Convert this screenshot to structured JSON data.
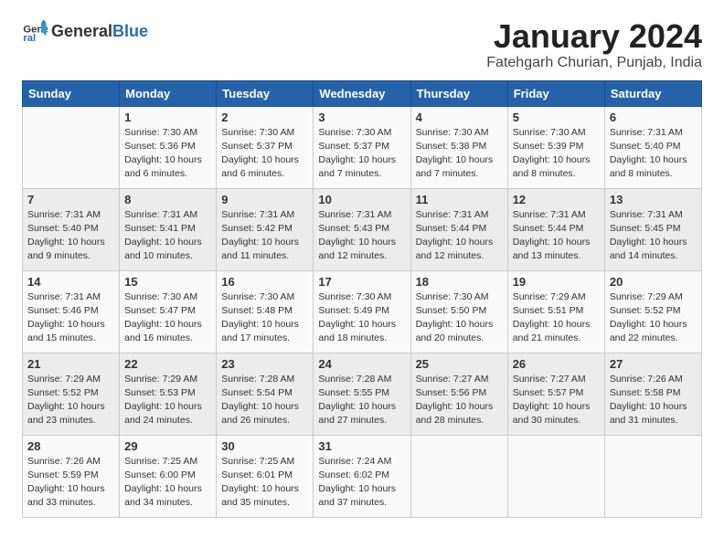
{
  "header": {
    "logo_general": "General",
    "logo_blue": "Blue",
    "title": "January 2024",
    "subtitle": "Fatehgarh Churian, Punjab, India"
  },
  "columns": [
    "Sunday",
    "Monday",
    "Tuesday",
    "Wednesday",
    "Thursday",
    "Friday",
    "Saturday"
  ],
  "weeks": [
    [
      {
        "day": "",
        "info": ""
      },
      {
        "day": "1",
        "info": "Sunrise: 7:30 AM\nSunset: 5:36 PM\nDaylight: 10 hours\nand 6 minutes."
      },
      {
        "day": "2",
        "info": "Sunrise: 7:30 AM\nSunset: 5:37 PM\nDaylight: 10 hours\nand 6 minutes."
      },
      {
        "day": "3",
        "info": "Sunrise: 7:30 AM\nSunset: 5:37 PM\nDaylight: 10 hours\nand 7 minutes."
      },
      {
        "day": "4",
        "info": "Sunrise: 7:30 AM\nSunset: 5:38 PM\nDaylight: 10 hours\nand 7 minutes."
      },
      {
        "day": "5",
        "info": "Sunrise: 7:30 AM\nSunset: 5:39 PM\nDaylight: 10 hours\nand 8 minutes."
      },
      {
        "day": "6",
        "info": "Sunrise: 7:31 AM\nSunset: 5:40 PM\nDaylight: 10 hours\nand 8 minutes."
      }
    ],
    [
      {
        "day": "7",
        "info": "Sunrise: 7:31 AM\nSunset: 5:40 PM\nDaylight: 10 hours\nand 9 minutes."
      },
      {
        "day": "8",
        "info": "Sunrise: 7:31 AM\nSunset: 5:41 PM\nDaylight: 10 hours\nand 10 minutes."
      },
      {
        "day": "9",
        "info": "Sunrise: 7:31 AM\nSunset: 5:42 PM\nDaylight: 10 hours\nand 11 minutes."
      },
      {
        "day": "10",
        "info": "Sunrise: 7:31 AM\nSunset: 5:43 PM\nDaylight: 10 hours\nand 12 minutes."
      },
      {
        "day": "11",
        "info": "Sunrise: 7:31 AM\nSunset: 5:44 PM\nDaylight: 10 hours\nand 12 minutes."
      },
      {
        "day": "12",
        "info": "Sunrise: 7:31 AM\nSunset: 5:44 PM\nDaylight: 10 hours\nand 13 minutes."
      },
      {
        "day": "13",
        "info": "Sunrise: 7:31 AM\nSunset: 5:45 PM\nDaylight: 10 hours\nand 14 minutes."
      }
    ],
    [
      {
        "day": "14",
        "info": "Sunrise: 7:31 AM\nSunset: 5:46 PM\nDaylight: 10 hours\nand 15 minutes."
      },
      {
        "day": "15",
        "info": "Sunrise: 7:30 AM\nSunset: 5:47 PM\nDaylight: 10 hours\nand 16 minutes."
      },
      {
        "day": "16",
        "info": "Sunrise: 7:30 AM\nSunset: 5:48 PM\nDaylight: 10 hours\nand 17 minutes."
      },
      {
        "day": "17",
        "info": "Sunrise: 7:30 AM\nSunset: 5:49 PM\nDaylight: 10 hours\nand 18 minutes."
      },
      {
        "day": "18",
        "info": "Sunrise: 7:30 AM\nSunset: 5:50 PM\nDaylight: 10 hours\nand 20 minutes."
      },
      {
        "day": "19",
        "info": "Sunrise: 7:29 AM\nSunset: 5:51 PM\nDaylight: 10 hours\nand 21 minutes."
      },
      {
        "day": "20",
        "info": "Sunrise: 7:29 AM\nSunset: 5:52 PM\nDaylight: 10 hours\nand 22 minutes."
      }
    ],
    [
      {
        "day": "21",
        "info": "Sunrise: 7:29 AM\nSunset: 5:52 PM\nDaylight: 10 hours\nand 23 minutes."
      },
      {
        "day": "22",
        "info": "Sunrise: 7:29 AM\nSunset: 5:53 PM\nDaylight: 10 hours\nand 24 minutes."
      },
      {
        "day": "23",
        "info": "Sunrise: 7:28 AM\nSunset: 5:54 PM\nDaylight: 10 hours\nand 26 minutes."
      },
      {
        "day": "24",
        "info": "Sunrise: 7:28 AM\nSunset: 5:55 PM\nDaylight: 10 hours\nand 27 minutes."
      },
      {
        "day": "25",
        "info": "Sunrise: 7:27 AM\nSunset: 5:56 PM\nDaylight: 10 hours\nand 28 minutes."
      },
      {
        "day": "26",
        "info": "Sunrise: 7:27 AM\nSunset: 5:57 PM\nDaylight: 10 hours\nand 30 minutes."
      },
      {
        "day": "27",
        "info": "Sunrise: 7:26 AM\nSunset: 5:58 PM\nDaylight: 10 hours\nand 31 minutes."
      }
    ],
    [
      {
        "day": "28",
        "info": "Sunrise: 7:26 AM\nSunset: 5:59 PM\nDaylight: 10 hours\nand 33 minutes."
      },
      {
        "day": "29",
        "info": "Sunrise: 7:25 AM\nSunset: 6:00 PM\nDaylight: 10 hours\nand 34 minutes."
      },
      {
        "day": "30",
        "info": "Sunrise: 7:25 AM\nSunset: 6:01 PM\nDaylight: 10 hours\nand 35 minutes."
      },
      {
        "day": "31",
        "info": "Sunrise: 7:24 AM\nSunset: 6:02 PM\nDaylight: 10 hours\nand 37 minutes."
      },
      {
        "day": "",
        "info": ""
      },
      {
        "day": "",
        "info": ""
      },
      {
        "day": "",
        "info": ""
      }
    ]
  ]
}
